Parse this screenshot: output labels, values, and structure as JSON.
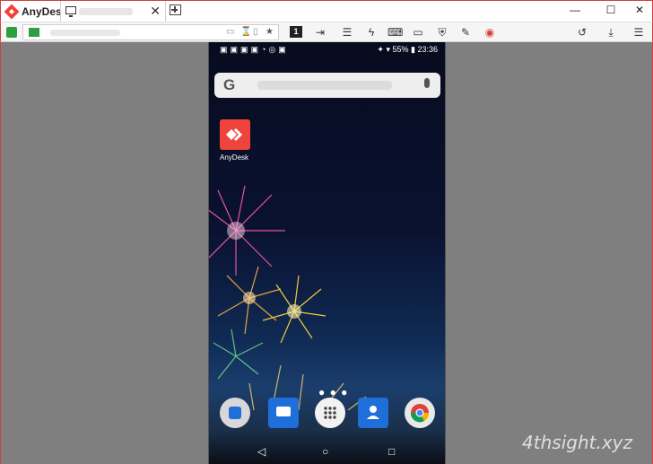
{
  "window": {
    "app_title": "AnyDesk",
    "tab_close": "✕",
    "controls": {
      "minimize": "—",
      "maximize": "☐",
      "close": "✕"
    }
  },
  "toolbar": {
    "display_number": "1",
    "icons": [
      "file-transfer-icon",
      "chat-icon",
      "actions-icon",
      "keyboard-icon",
      "display-icon",
      "permissions-icon",
      "whiteboard-icon",
      "record-icon",
      "history-icon",
      "download-icon",
      "menu-icon"
    ]
  },
  "phone": {
    "status": {
      "time": "23:36",
      "battery": "55%"
    },
    "search": {
      "logo": "G"
    },
    "home_app_label": "AnyDesk",
    "dock_apps": [
      "phone",
      "messages",
      "app-drawer",
      "contacts",
      "chrome"
    ],
    "nav": {
      "back": "◁",
      "home": "○",
      "recents": "□"
    }
  },
  "watermark": "4thsight.xyz",
  "colors": {
    "accent": "#ef443b",
    "status_green": "#2e9e40",
    "viewport_gray": "#7f7f7f"
  }
}
